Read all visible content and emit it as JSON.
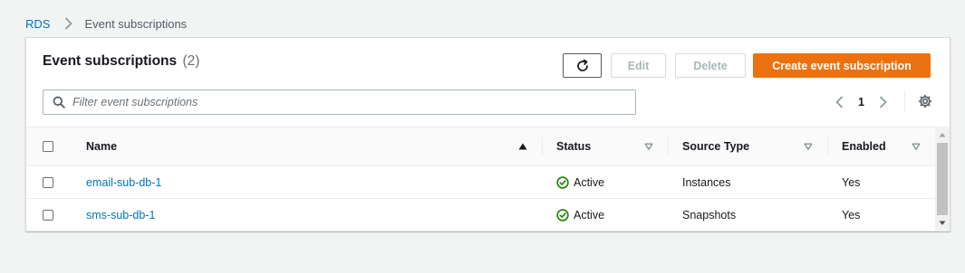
{
  "breadcrumb": {
    "root": "RDS",
    "current": "Event subscriptions"
  },
  "panel": {
    "title": "Event subscriptions",
    "count": "(2)"
  },
  "toolbar": {
    "refresh_icon": "refresh-icon",
    "edit_label": "Edit",
    "delete_label": "Delete",
    "create_label": "Create event subscription"
  },
  "search": {
    "placeholder": "Filter event subscriptions",
    "value": ""
  },
  "pagination": {
    "current_page": "1"
  },
  "table": {
    "columns": [
      "Name",
      "Status",
      "Source Type",
      "Enabled"
    ],
    "sort": {
      "column": "Name",
      "direction": "ascending"
    },
    "rows": [
      {
        "name": "email-sub-db-1",
        "status": "Active",
        "source_type": "Instances",
        "enabled": "Yes"
      },
      {
        "name": "sms-sub-db-1",
        "status": "Active",
        "source_type": "Snapshots",
        "enabled": "Yes"
      }
    ]
  },
  "colors": {
    "link": "#0073bb",
    "primary": "#ec7211",
    "success": "#1d8102",
    "background": "#f2f3f3"
  }
}
